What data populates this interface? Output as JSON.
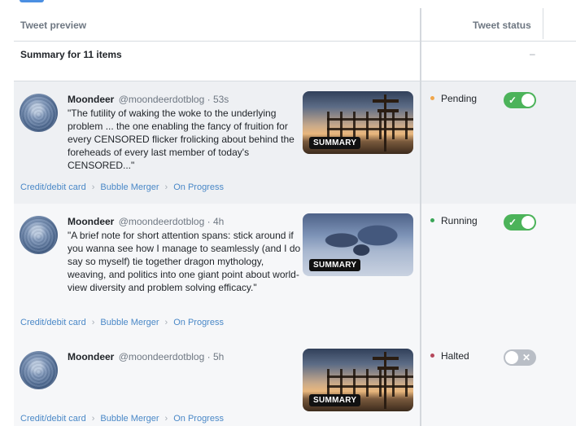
{
  "columns": {
    "preview": "Tweet preview",
    "status": "Tweet status"
  },
  "summary": {
    "label": "Summary for 11 items",
    "status": "–"
  },
  "rows": [
    {
      "author": "Moondeer",
      "handle": "@moondeerdotblog · 53s",
      "text": "\"The futility of waking the woke to the underlying problem ... the one enabling the fancy of fruition for every CENSORED flicker frolicking about behind the foreheads of every last member of today's CENSORED...\"",
      "badge": "SUMMARY",
      "crumbs": [
        "Credit/debit card",
        "Bubble Merger",
        "On Progress"
      ],
      "status": "Pending",
      "status_color": "#f0a64a",
      "toggle": "on",
      "toggle_icon": "checkmark-icon",
      "toggle_glyph": "✓"
    },
    {
      "author": "Moondeer",
      "handle": "@moondeerdotblog · 4h",
      "text": "\"A brief note for short attention spans: stick around if you wanna see how I manage to seamlessly (and I do say so myself) tie together dragon mythology, weaving, and politics into one giant point about world-view diversity and problem solving efficacy.\"",
      "badge": "SUMMARY",
      "crumbs": [
        "Credit/debit card",
        "Bubble Merger",
        "On Progress"
      ],
      "status": "Running",
      "status_color": "#3aa657",
      "toggle": "on",
      "toggle_icon": "checkmark-icon",
      "toggle_glyph": "✓"
    },
    {
      "author": "Moondeer",
      "handle": "@moondeerdotblog · 5h",
      "text": "",
      "badge": "SUMMARY",
      "crumbs": [
        "Credit/debit card",
        "Bubble Merger",
        "On Progress"
      ],
      "status": "Halted",
      "status_color": "#b5485c",
      "toggle": "off",
      "toggle_icon": "close-icon",
      "toggle_glyph": "✕"
    }
  ]
}
